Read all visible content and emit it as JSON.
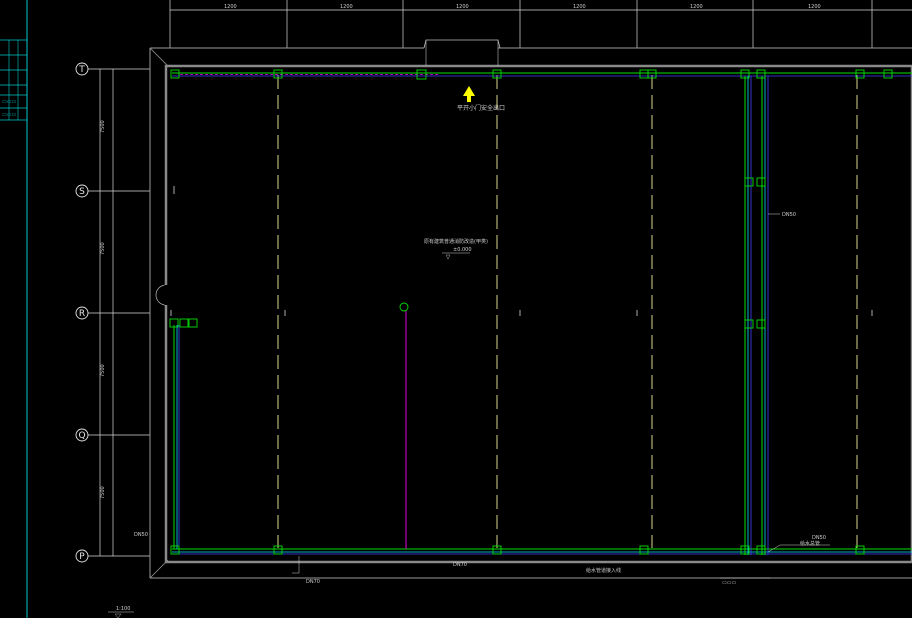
{
  "grid_axes": {
    "rows": [
      "T",
      "S",
      "R",
      "Q",
      "P"
    ],
    "columns_dims": [
      "1200",
      "1200",
      "1200",
      "1200",
      "1200",
      "1200"
    ],
    "row_dims": [
      "7500",
      "7500",
      "7500",
      "7500"
    ]
  },
  "annotations": {
    "exit_note": "平开小门安全出口",
    "room_note": "原有建筑普通消防改造(甲类)",
    "room_tag": "±0.000",
    "vert_label": "DN50",
    "bottom_label": "给水管道接入线",
    "bottom_tag_left": "DN70",
    "bottom_tag_mid": "DN70",
    "right_tag": "DN50",
    "corner_label": "给水总管",
    "scale_label": "1:100",
    "left_side_tag": "DN50"
  },
  "colors": {
    "wall": "#9a9a9a",
    "dim_line": "#d8d8d8",
    "grid_dash": "#eeee9a",
    "pipe_green": "#00e000",
    "pipe_cyan": "#00e0ff",
    "pipe_magenta": "#e000e0",
    "pipe_blue": "#4040ff",
    "arrow": "#ffff00",
    "frame_cyan": "#00c8c8"
  }
}
